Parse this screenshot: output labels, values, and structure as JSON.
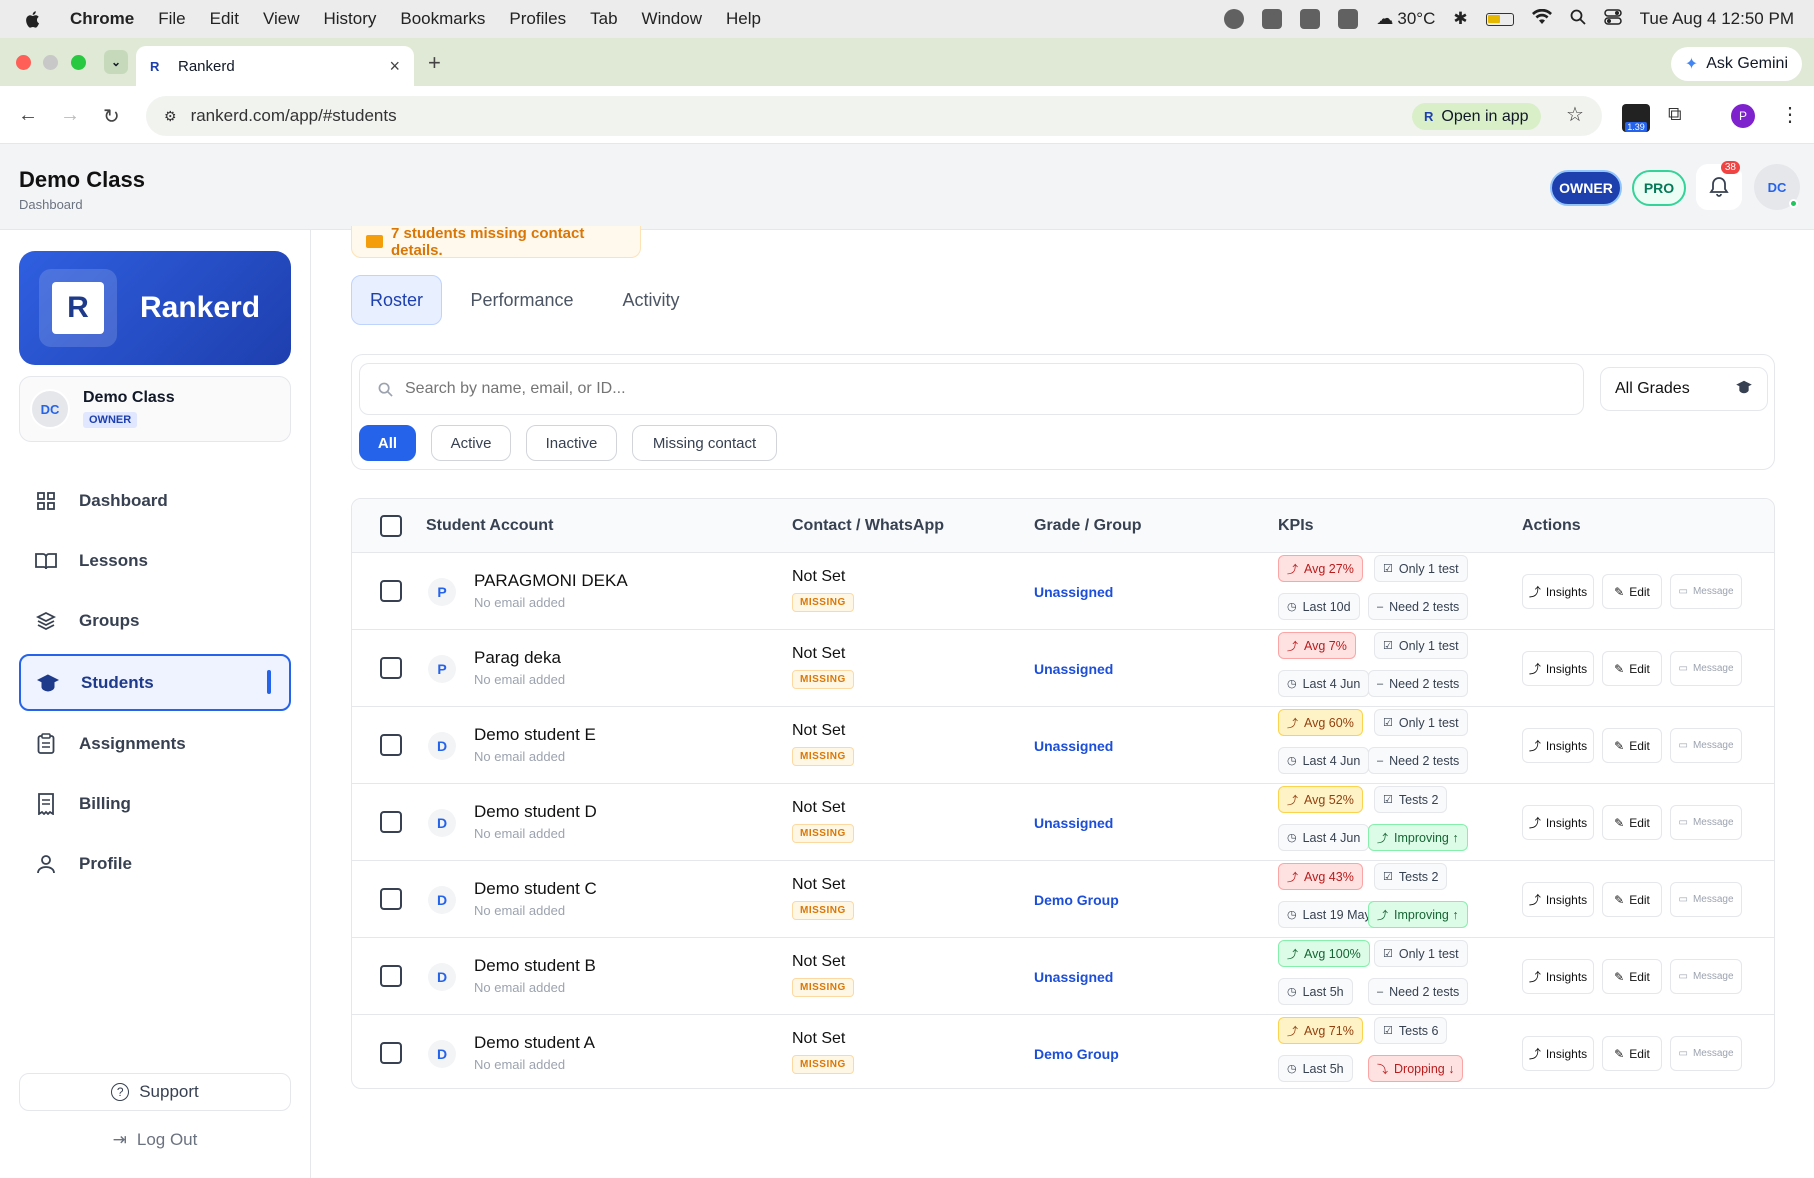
{
  "menubar": {
    "app": "Chrome",
    "items": [
      "File",
      "Edit",
      "View",
      "History",
      "Bookmarks",
      "Profiles",
      "Tab",
      "Window",
      "Help"
    ],
    "weather": "30°C",
    "datetime": "Tue Aug 4  12:50 PM"
  },
  "browser": {
    "tab_title": "Rankerd",
    "gemini_label": "Ask Gemini",
    "url": "rankerd.com/app/#students",
    "open_in_app": "Open in app",
    "ext_badge": "1.39",
    "profile_initial": "P"
  },
  "header": {
    "title": "Demo Class",
    "subtitle": "Dashboard",
    "owner_badge": "OWNER",
    "pro_badge": "PRO",
    "notif_count": "38",
    "avatar": "DC"
  },
  "sidebar": {
    "brand": "Rankerd",
    "class_name": "Demo Class",
    "class_role": "OWNER",
    "class_avatar": "DC",
    "items": [
      {
        "label": "Dashboard",
        "icon": "grid-icon"
      },
      {
        "label": "Lessons",
        "icon": "book-icon"
      },
      {
        "label": "Groups",
        "icon": "layers-icon"
      },
      {
        "label": "Students",
        "icon": "graduation-cap-icon",
        "active": true
      },
      {
        "label": "Assignments",
        "icon": "clipboard-icon"
      },
      {
        "label": "Billing",
        "icon": "receipt-icon"
      },
      {
        "label": "Profile",
        "icon": "user-icon"
      }
    ],
    "support": "Support",
    "logout": "Log Out"
  },
  "banner": "7 students missing contact details.",
  "tabs": [
    "Roster",
    "Performance",
    "Activity"
  ],
  "search": {
    "placeholder": "Search by name, email, or ID..."
  },
  "grade_select": "All Grades",
  "filters": [
    "All",
    "Active",
    "Inactive",
    "Missing contact"
  ],
  "table": {
    "headers": [
      "Student Account",
      "Contact / WhatsApp",
      "Grade / Group",
      "KPIs",
      "Actions"
    ],
    "actions": {
      "insights": "Insights",
      "edit": "Edit",
      "message": "Message"
    },
    "rows": [
      {
        "initial": "P",
        "name": "PARAGMONI DEKA",
        "email": "No email added",
        "contact": "Not Set",
        "contact_status": "MISSING",
        "group": "Unassigned",
        "kpi": [
          {
            "text": "Avg 27%",
            "tone": "red"
          },
          {
            "text": "Only 1 test",
            "tone": "gray"
          },
          {
            "text": "Last 10d",
            "tone": "gray"
          },
          {
            "text": "Need 2 tests",
            "tone": "gray"
          }
        ]
      },
      {
        "initial": "P",
        "name": "Parag deka",
        "email": "No email added",
        "contact": "Not Set",
        "contact_status": "MISSING",
        "group": "Unassigned",
        "kpi": [
          {
            "text": "Avg 7%",
            "tone": "red"
          },
          {
            "text": "Only 1 test",
            "tone": "gray"
          },
          {
            "text": "Last 4 Jun",
            "tone": "gray"
          },
          {
            "text": "Need 2 tests",
            "tone": "gray"
          }
        ]
      },
      {
        "initial": "D",
        "name": "Demo student E",
        "email": "No email added",
        "contact": "Not Set",
        "contact_status": "MISSING",
        "group": "Unassigned",
        "kpi": [
          {
            "text": "Avg 60%",
            "tone": "amber"
          },
          {
            "text": "Only 1 test",
            "tone": "gray"
          },
          {
            "text": "Last 4 Jun",
            "tone": "gray"
          },
          {
            "text": "Need 2 tests",
            "tone": "gray"
          }
        ]
      },
      {
        "initial": "D",
        "name": "Demo student D",
        "email": "No email added",
        "contact": "Not Set",
        "contact_status": "MISSING",
        "group": "Unassigned",
        "kpi": [
          {
            "text": "Avg 52%",
            "tone": "amber"
          },
          {
            "text": "Tests 2",
            "tone": "gray"
          },
          {
            "text": "Last 4 Jun",
            "tone": "gray"
          },
          {
            "text": "Improving ↑",
            "tone": "green"
          }
        ]
      },
      {
        "initial": "D",
        "name": "Demo student C",
        "email": "No email added",
        "contact": "Not Set",
        "contact_status": "MISSING",
        "group": "Demo Group",
        "kpi": [
          {
            "text": "Avg 43%",
            "tone": "red"
          },
          {
            "text": "Tests 2",
            "tone": "gray"
          },
          {
            "text": "Last 19 May",
            "tone": "gray"
          },
          {
            "text": "Improving ↑",
            "tone": "green"
          }
        ]
      },
      {
        "initial": "D",
        "name": "Demo student B",
        "email": "No email added",
        "contact": "Not Set",
        "contact_status": "MISSING",
        "group": "Unassigned",
        "kpi": [
          {
            "text": "Avg 100%",
            "tone": "green"
          },
          {
            "text": "Only 1 test",
            "tone": "gray"
          },
          {
            "text": "Last 5h",
            "tone": "gray"
          },
          {
            "text": "Need 2 tests",
            "tone": "gray"
          }
        ]
      },
      {
        "initial": "D",
        "name": "Demo student A",
        "email": "No email added",
        "contact": "Not Set",
        "contact_status": "MISSING",
        "group": "Demo Group",
        "kpi": [
          {
            "text": "Avg 71%",
            "tone": "amber"
          },
          {
            "text": "Tests 6",
            "tone": "gray"
          },
          {
            "text": "Last 5h",
            "tone": "gray"
          },
          {
            "text": "Dropping ↓",
            "tone": "red"
          }
        ]
      }
    ]
  },
  "colors": {
    "accent": "#2563eb",
    "brand_dark": "#1e3fae",
    "warning": "#d97706"
  }
}
